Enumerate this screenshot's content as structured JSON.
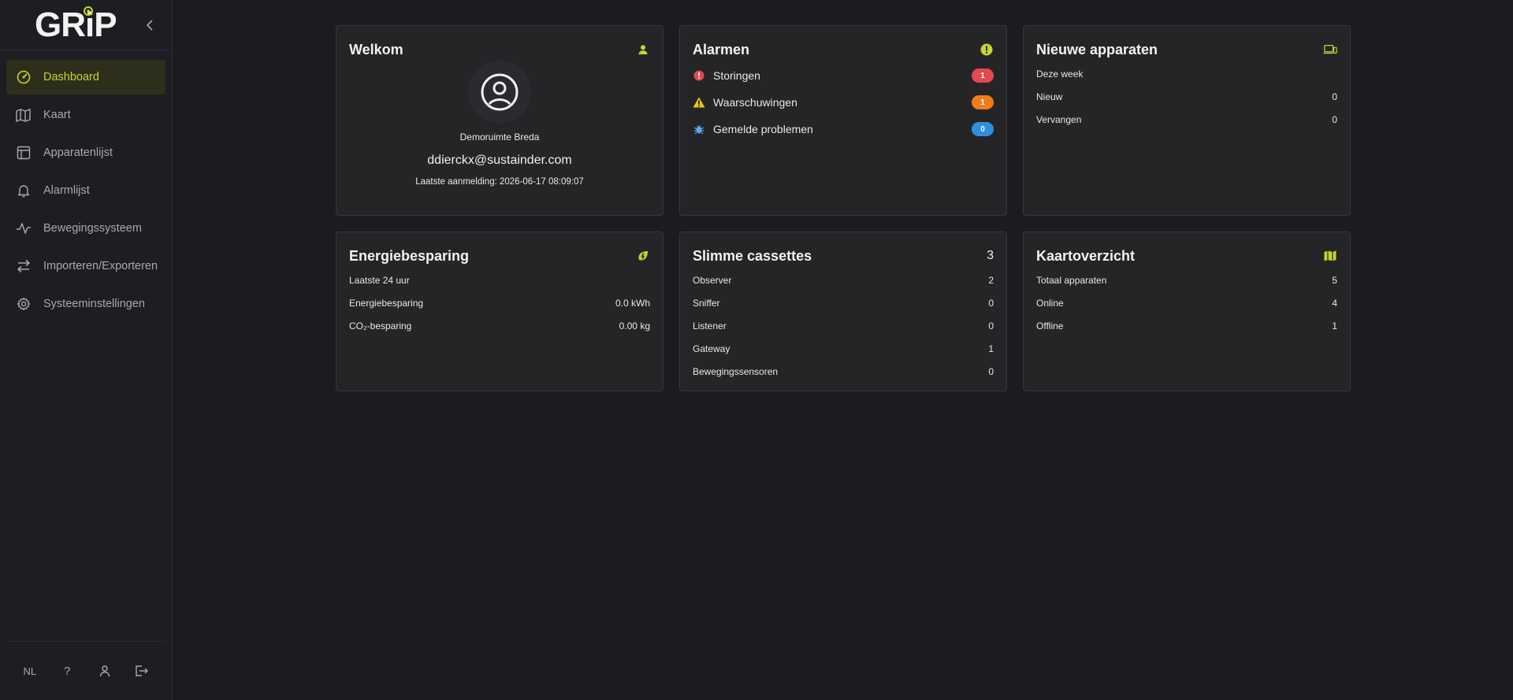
{
  "app": {
    "logo_text": "GRiP"
  },
  "sidebar": {
    "items": [
      {
        "label": "Dashboard",
        "icon": "dashboard-icon",
        "active": true
      },
      {
        "label": "Kaart",
        "icon": "map-icon"
      },
      {
        "label": "Apparatenlijst",
        "icon": "table-icon"
      },
      {
        "label": "Alarmlijst",
        "icon": "bell-icon"
      },
      {
        "label": "Bewegingssysteem",
        "icon": "activity-icon"
      },
      {
        "label": "Importeren/Exporteren",
        "icon": "swap-arrows-icon"
      },
      {
        "label": "Systeeminstellingen",
        "icon": "gear-icon"
      }
    ],
    "bottom": {
      "language": "NL",
      "help": "?"
    }
  },
  "welcome": {
    "title": "Welkom",
    "organization": "Demoruimte Breda",
    "email": "ddierckx@sustainder.com",
    "last_login": "Laatste aanmelding: 2026-06-17 08:09:07"
  },
  "alarms": {
    "title": "Alarmen",
    "items": [
      {
        "label": "Storingen",
        "count": "1",
        "color": "#e5484d"
      },
      {
        "label": "Waarschuwingen",
        "count": "1",
        "color": "#f07d1a"
      },
      {
        "label": "Gemelde problemen",
        "count": "0",
        "color": "#2f8fe0"
      }
    ]
  },
  "new_devices": {
    "title": "Nieuwe apparaten",
    "period": "Deze week",
    "rows": [
      {
        "label": "Nieuw",
        "value": "0"
      },
      {
        "label": "Vervangen",
        "value": "0"
      }
    ]
  },
  "energy": {
    "title": "Energiebesparing",
    "period": "Laatste 24 uur",
    "rows": [
      {
        "label": "Energiebesparing",
        "value": "0.0 kWh"
      },
      {
        "label": "CO₂-besparing",
        "value": "0.00 kg"
      }
    ]
  },
  "cassettes": {
    "title": "Slimme cassettes",
    "total": "3",
    "rows": [
      {
        "label": "Observer",
        "value": "2"
      },
      {
        "label": "Sniffer",
        "value": "0"
      },
      {
        "label": "Listener",
        "value": "0"
      },
      {
        "label": "Gateway",
        "value": "1"
      },
      {
        "label": "Bewegingssensoren",
        "value": "0"
      }
    ]
  },
  "map_overview": {
    "title": "Kaartoverzicht",
    "rows": [
      {
        "label": "Totaal apparaten",
        "value": "5"
      },
      {
        "label": "Online",
        "value": "4"
      },
      {
        "label": "Offline",
        "value": "1"
      }
    ]
  },
  "colors": {
    "accent": "#c9d42c",
    "background": "#1b1c1f",
    "card": "#252528"
  }
}
